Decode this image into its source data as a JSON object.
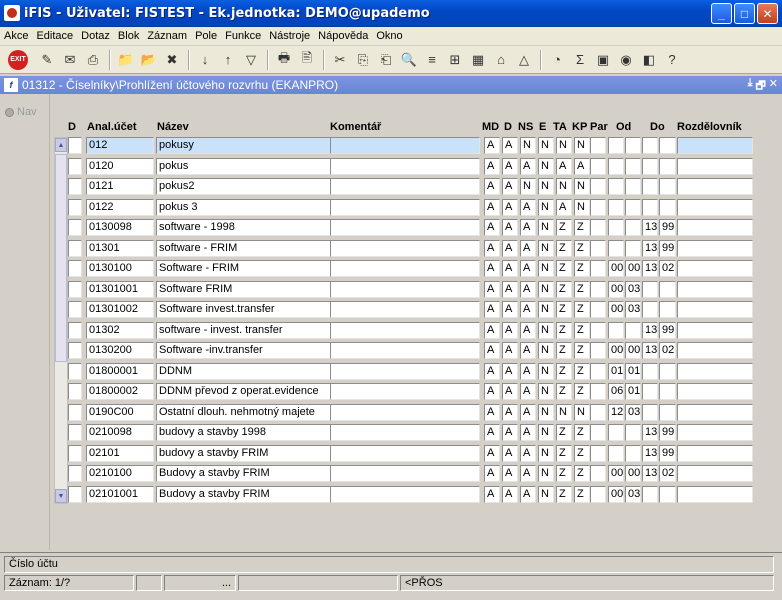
{
  "window": {
    "title": "iFIS - Uživatel: FISTEST - Ek.jednotka: DEMO@upademo",
    "min": "_",
    "max": "□",
    "close": "✕"
  },
  "menu": [
    "Akce",
    "Editace",
    "Dotaz",
    "Blok",
    "Záznam",
    "Pole",
    "Funkce",
    "Nástroje",
    "Nápověda",
    "Okno"
  ],
  "toolbar": {
    "exit_label": "EXIT",
    "icons": [
      "✎",
      "✉",
      "⎙",
      "📁",
      "📂",
      "✖",
      "↓",
      "↑",
      "▽",
      "🖶",
      "🖹",
      "✂",
      "⎘",
      "⎗",
      "🔍",
      "≡",
      "⊞",
      "▦",
      "⌂",
      "△",
      "◔",
      "Σ",
      "▣",
      "◉",
      "◧",
      "?"
    ]
  },
  "inner": {
    "icon": "f",
    "title": "01312 - Číselníky\\Prohlížení účtového rozvrhu (EKANPRO)",
    "buttons": [
      "⤓",
      "🗗",
      "✕"
    ]
  },
  "nav": {
    "label": "Nav"
  },
  "columns": {
    "d": "D",
    "anal": "Anal.účet",
    "nazev": "Název",
    "komentar": "Komentář",
    "md": "MD",
    "d2": "D",
    "ns": "NS",
    "e": "E",
    "ta": "TA",
    "kp": "KP",
    "par": "Par",
    "od": "Od",
    "do": "Do",
    "rozdelovnik": "Rozdělovník"
  },
  "scroll": {
    "up": "▲",
    "down": "▼"
  },
  "rows": [
    {
      "anal": "012",
      "nazev": "pokusy",
      "md": "A",
      "d": "A",
      "ns": "N",
      "e": "N",
      "ta": "N",
      "kp": "N",
      "od1": "",
      "od2": "",
      "do1": "",
      "do2": ""
    },
    {
      "anal": "0120",
      "nazev": "pokus",
      "md": "A",
      "d": "A",
      "ns": "A",
      "e": "N",
      "ta": "A",
      "kp": "A",
      "od1": "",
      "od2": "",
      "do1": "",
      "do2": ""
    },
    {
      "anal": "0121",
      "nazev": "pokus2",
      "md": "A",
      "d": "A",
      "ns": "N",
      "e": "N",
      "ta": "N",
      "kp": "N",
      "od1": "",
      "od2": "",
      "do1": "",
      "do2": ""
    },
    {
      "anal": "0122",
      "nazev": "pokus 3",
      "md": "A",
      "d": "A",
      "ns": "A",
      "e": "N",
      "ta": "A",
      "kp": "N",
      "od1": "",
      "od2": "",
      "do1": "",
      "do2": ""
    },
    {
      "anal": "0130098",
      "nazev": "software - 1998",
      "md": "A",
      "d": "A",
      "ns": "A",
      "e": "N",
      "ta": "Z",
      "kp": "Z",
      "od1": "",
      "od2": "",
      "do1": "13",
      "do2": "99"
    },
    {
      "anal": "01301",
      "nazev": "software - FRIM",
      "md": "A",
      "d": "A",
      "ns": "A",
      "e": "N",
      "ta": "Z",
      "kp": "Z",
      "od1": "",
      "od2": "",
      "do1": "13",
      "do2": "99"
    },
    {
      "anal": "0130100",
      "nazev": "Software - FRIM",
      "md": "A",
      "d": "A",
      "ns": "A",
      "e": "N",
      "ta": "Z",
      "kp": "Z",
      "od1": "00",
      "od2": "00",
      "do1": "13",
      "do2": "02"
    },
    {
      "anal": "01301001",
      "nazev": "Software FRIM",
      "md": "A",
      "d": "A",
      "ns": "A",
      "e": "N",
      "ta": "Z",
      "kp": "Z",
      "od1": "00",
      "od2": "03",
      "do1": "",
      "do2": ""
    },
    {
      "anal": "01301002",
      "nazev": "Software invest.transfer",
      "md": "A",
      "d": "A",
      "ns": "A",
      "e": "N",
      "ta": "Z",
      "kp": "Z",
      "od1": "00",
      "od2": "03",
      "do1": "",
      "do2": ""
    },
    {
      "anal": "01302",
      "nazev": "software - invest. transfer",
      "md": "A",
      "d": "A",
      "ns": "A",
      "e": "N",
      "ta": "Z",
      "kp": "Z",
      "od1": "",
      "od2": "",
      "do1": "13",
      "do2": "99"
    },
    {
      "anal": "0130200",
      "nazev": "Software -inv.transfer",
      "md": "A",
      "d": "A",
      "ns": "A",
      "e": "N",
      "ta": "Z",
      "kp": "Z",
      "od1": "00",
      "od2": "00",
      "do1": "13",
      "do2": "02"
    },
    {
      "anal": "01800001",
      "nazev": "DDNM",
      "md": "A",
      "d": "A",
      "ns": "A",
      "e": "N",
      "ta": "Z",
      "kp": "Z",
      "od1": "01",
      "od2": "01",
      "do1": "",
      "do2": ""
    },
    {
      "anal": "01800002",
      "nazev": "DDNM převod z operat.evidence",
      "md": "A",
      "d": "A",
      "ns": "A",
      "e": "N",
      "ta": "Z",
      "kp": "Z",
      "od1": "06",
      "od2": "01",
      "do1": "",
      "do2": ""
    },
    {
      "anal": "0190C00",
      "nazev": "Ostatní dlouh. nehmotný majete",
      "md": "A",
      "d": "A",
      "ns": "A",
      "e": "N",
      "ta": "N",
      "kp": "N",
      "od1": "12",
      "od2": "03",
      "do1": "",
      "do2": ""
    },
    {
      "anal": "0210098",
      "nazev": "budovy a stavby 1998",
      "md": "A",
      "d": "A",
      "ns": "A",
      "e": "N",
      "ta": "Z",
      "kp": "Z",
      "od1": "",
      "od2": "",
      "do1": "13",
      "do2": "99"
    },
    {
      "anal": "02101",
      "nazev": "budovy a stavby FRIM",
      "md": "A",
      "d": "A",
      "ns": "A",
      "e": "N",
      "ta": "Z",
      "kp": "Z",
      "od1": "",
      "od2": "",
      "do1": "13",
      "do2": "99"
    },
    {
      "anal": "0210100",
      "nazev": "Budovy a stavby FRIM",
      "md": "A",
      "d": "A",
      "ns": "A",
      "e": "N",
      "ta": "Z",
      "kp": "Z",
      "od1": "00",
      "od2": "00",
      "do1": "13",
      "do2": "02"
    },
    {
      "anal": "02101001",
      "nazev": "Budovy a stavby FRIM",
      "md": "A",
      "d": "A",
      "ns": "A",
      "e": "N",
      "ta": "Z",
      "kp": "Z",
      "od1": "00",
      "od2": "03",
      "do1": "",
      "do2": ""
    }
  ],
  "status": {
    "hint": "Číslo účtu",
    "record": "Záznam: 1/?",
    "dots": "...",
    "mode": "<PŘOS"
  }
}
